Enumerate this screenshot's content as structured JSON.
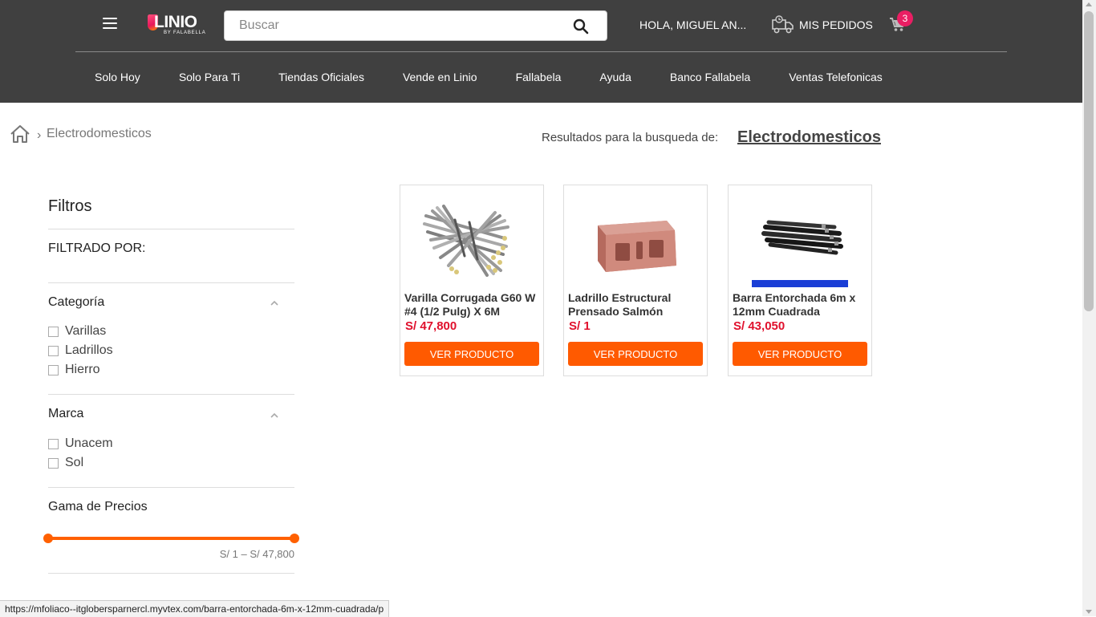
{
  "header": {
    "logo_text": "LINIO",
    "logo_subtext": "BY FALABELLA",
    "search_placeholder": "Buscar",
    "greeting": "HOLA, MIGUEL AN...",
    "orders_label": "MIS PEDIDOS",
    "cart_count": "3"
  },
  "nav": {
    "items": [
      {
        "label": "Solo Hoy"
      },
      {
        "label": "Solo Para Ti"
      },
      {
        "label": "Tiendas Oficiales"
      },
      {
        "label": "Vende en Linio"
      },
      {
        "label": "Fallabela"
      },
      {
        "label": "Ayuda"
      },
      {
        "label": "Banco Fallabela"
      },
      {
        "label": "Ventas Telefonicas"
      }
    ]
  },
  "breadcrumb": {
    "separator": "›",
    "current": "Electrodomesticos"
  },
  "results": {
    "label": "Resultados para la busqueda de:",
    "term": "Electrodomesticos"
  },
  "filters": {
    "title": "Filtros",
    "filtered_by": "FILTRADO POR:",
    "category": {
      "title": "Categoría",
      "options": [
        "Varillas",
        "Ladrillos",
        "Hierro"
      ]
    },
    "brand": {
      "title": "Marca",
      "options": [
        "Unacem",
        "Sol"
      ]
    },
    "price": {
      "title": "Gama de Precios",
      "range_text": "S/ 1 – S/ 47,800",
      "min_fraction": 0,
      "max_fraction": 1
    }
  },
  "products": [
    {
      "title": "Varilla Corrugada G60 W #4 (1/2 Pulg) X 6M",
      "price": "S/ 47,800",
      "button": "VER PRODUCTO"
    },
    {
      "title": "Ladrillo Estructural Prensado Salmón",
      "price": "S/ 1",
      "button": "VER PRODUCTO"
    },
    {
      "title": "Barra Entorchada 6m x 12mm Cuadrada",
      "price": "S/ 43,050",
      "button": "VER PRODUCTO"
    }
  ],
  "status_bar": {
    "url": "https://mfoliaco--itglobersparnercl.myvtex.com/barra-entorchada-6m-x-12mm-cuadrada/p"
  },
  "colors": {
    "header_bg": "#404040",
    "accent": "#ff5a00",
    "price": "#e0102c",
    "badge": "#e91e63"
  }
}
